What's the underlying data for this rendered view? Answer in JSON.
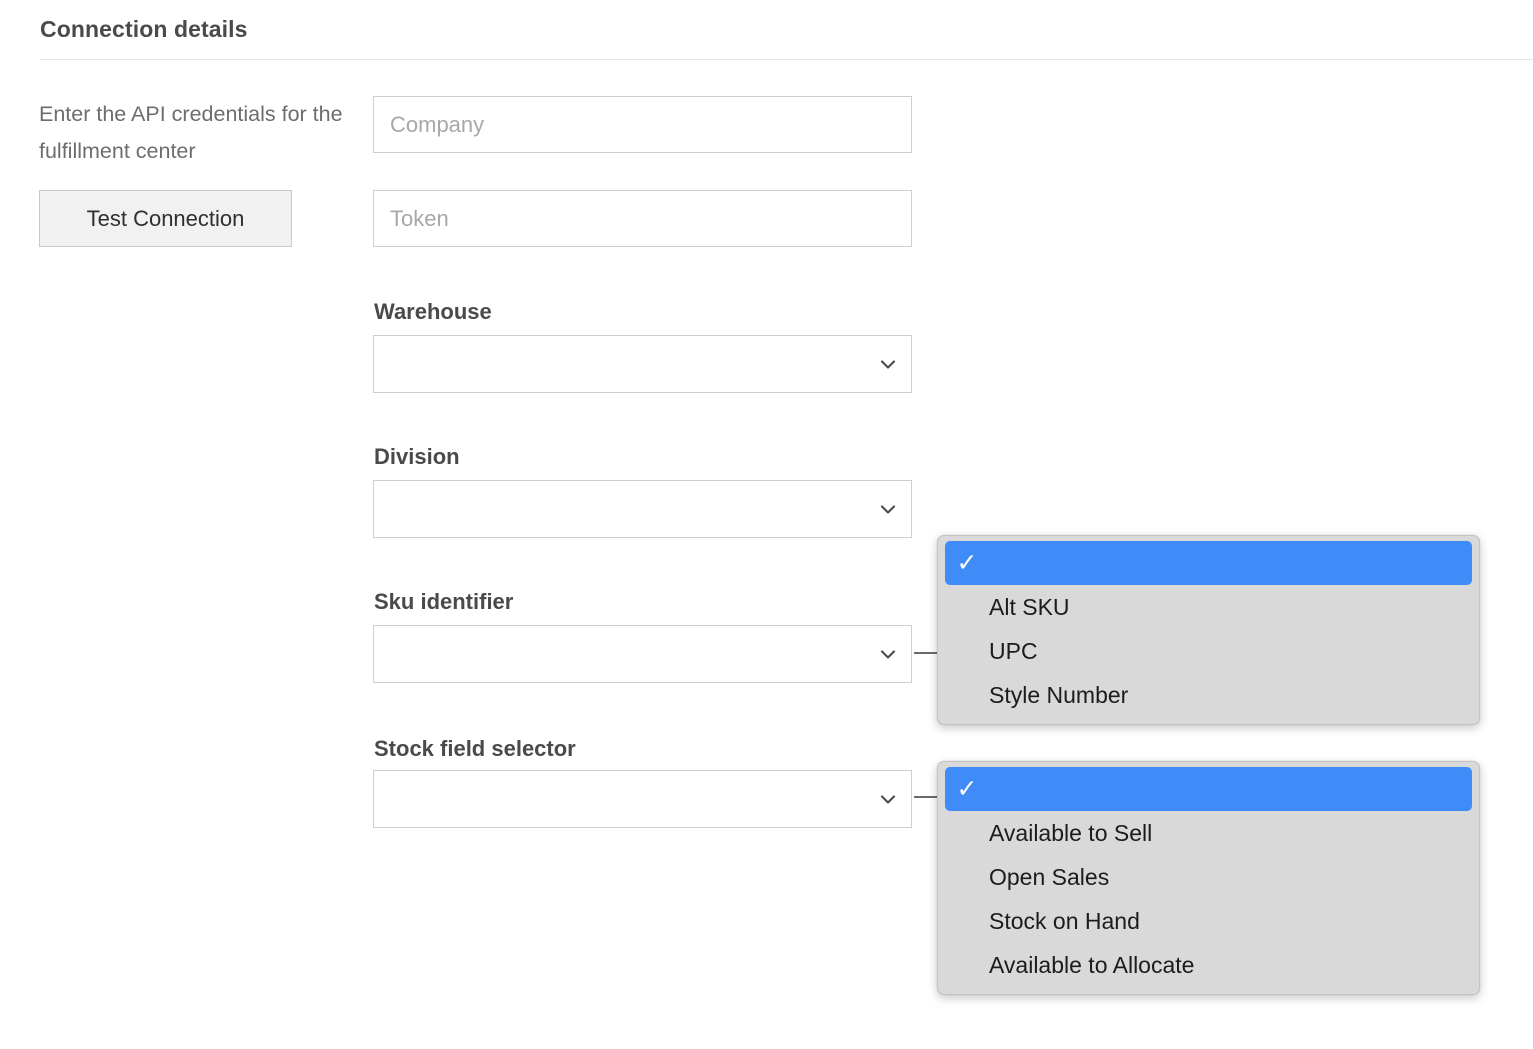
{
  "header": {
    "title": "Connection details"
  },
  "left_column": {
    "help_text": "Enter the API credentials for the fulfillment center",
    "test_connection_label": "Test Connection"
  },
  "form": {
    "company_field": {
      "name": "Company",
      "placeholder": "Company",
      "value": ""
    },
    "token_field": {
      "name": "Token",
      "placeholder": "Token",
      "value": ""
    },
    "warehouse": {
      "label": "Warehouse",
      "selected": ""
    },
    "division": {
      "label": "Division",
      "selected": ""
    },
    "sku_identifier": {
      "label": "Sku identifier",
      "selected": ""
    },
    "stock_field_selector": {
      "label": "Stock field selector",
      "selected": ""
    }
  },
  "popups": {
    "sku_identifier_menu": {
      "options": [
        {
          "label": "",
          "selected": true
        },
        {
          "label": "Alt SKU",
          "selected": false
        },
        {
          "label": "UPC",
          "selected": false
        },
        {
          "label": "Style Number",
          "selected": false
        }
      ]
    },
    "stock_field_menu": {
      "options": [
        {
          "label": "",
          "selected": true
        },
        {
          "label": "Available to Sell",
          "selected": false
        },
        {
          "label": "Open Sales",
          "selected": false
        },
        {
          "label": "Stock on Hand",
          "selected": false
        },
        {
          "label": "Available to Allocate",
          "selected": false
        }
      ]
    }
  },
  "icons": {
    "chevron_down": "chevron-down-icon",
    "checkmark": "✓"
  },
  "colors": {
    "accent_blue": "#3f8bf8",
    "popup_background": "#d9d9d9",
    "label_text": "#4a4a4a",
    "help_text": "#6d6d6d",
    "placeholder": "#a8a8a8",
    "border": "#cfcfcf",
    "button_background": "#f1f1f1"
  }
}
